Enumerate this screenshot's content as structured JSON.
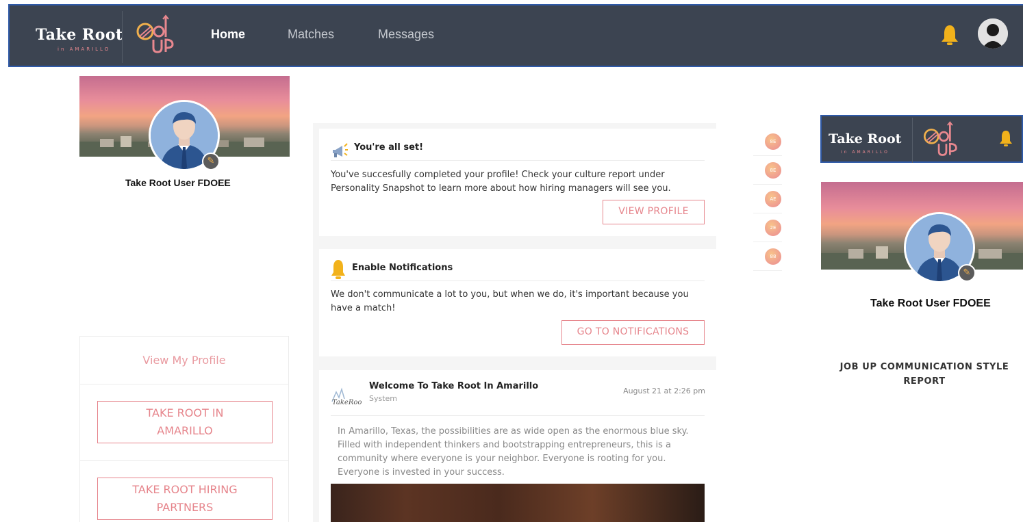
{
  "nav": {
    "brand": "Take Root",
    "brand_sub": "in AMARILLO",
    "items": [
      {
        "label": "Home",
        "active": true
      },
      {
        "label": "Matches",
        "active": false
      },
      {
        "label": "Messages",
        "active": false
      }
    ]
  },
  "profile": {
    "name": "Take Root User FDOEE"
  },
  "left_menu": {
    "view_profile": "View My Profile",
    "buttons": [
      "TAKE ROOT IN AMARILLO",
      "TAKE ROOT HIRING PARTNERS"
    ]
  },
  "feed": {
    "cards": [
      {
        "title": "You're all set!",
        "text": "You've succesfully completed your profile! Check your culture report under Personality Snapshot to learn more about how hiring managers will see you.",
        "button": "VIEW PROFILE"
      },
      {
        "title": "Enable Notifications",
        "text": "We don't communicate a lot to you, but when we do, it's important because you have a match!",
        "button": "GO TO NOTIFICATIONS"
      }
    ],
    "post": {
      "title": "Welcome To Take Root In Amarillo",
      "author": "System",
      "date": "August 21 at 2:26 pm",
      "text": "In Amarillo, Texas, the possibilities are as wide open as the enormous blue sky. Filled with independent thinkers and bootstrapping entrepreneurs, this is a community where everyone is your neighbor. Everyone is rooting for you. Everyone is invested in your success."
    }
  },
  "match_dots": [
    "8E",
    "8E",
    "AE",
    "2E",
    "88"
  ],
  "right_panel": {
    "brand": "Take Root",
    "brand_sub": "in AMARILLO",
    "name": "Take Root User FDOEE",
    "report_title": "JOB UP COMMUNICATION STYLE REPORT"
  },
  "colors": {
    "nav_bg": "#3c4451",
    "accent": "#e6858c",
    "bell": "#f2b21b"
  }
}
